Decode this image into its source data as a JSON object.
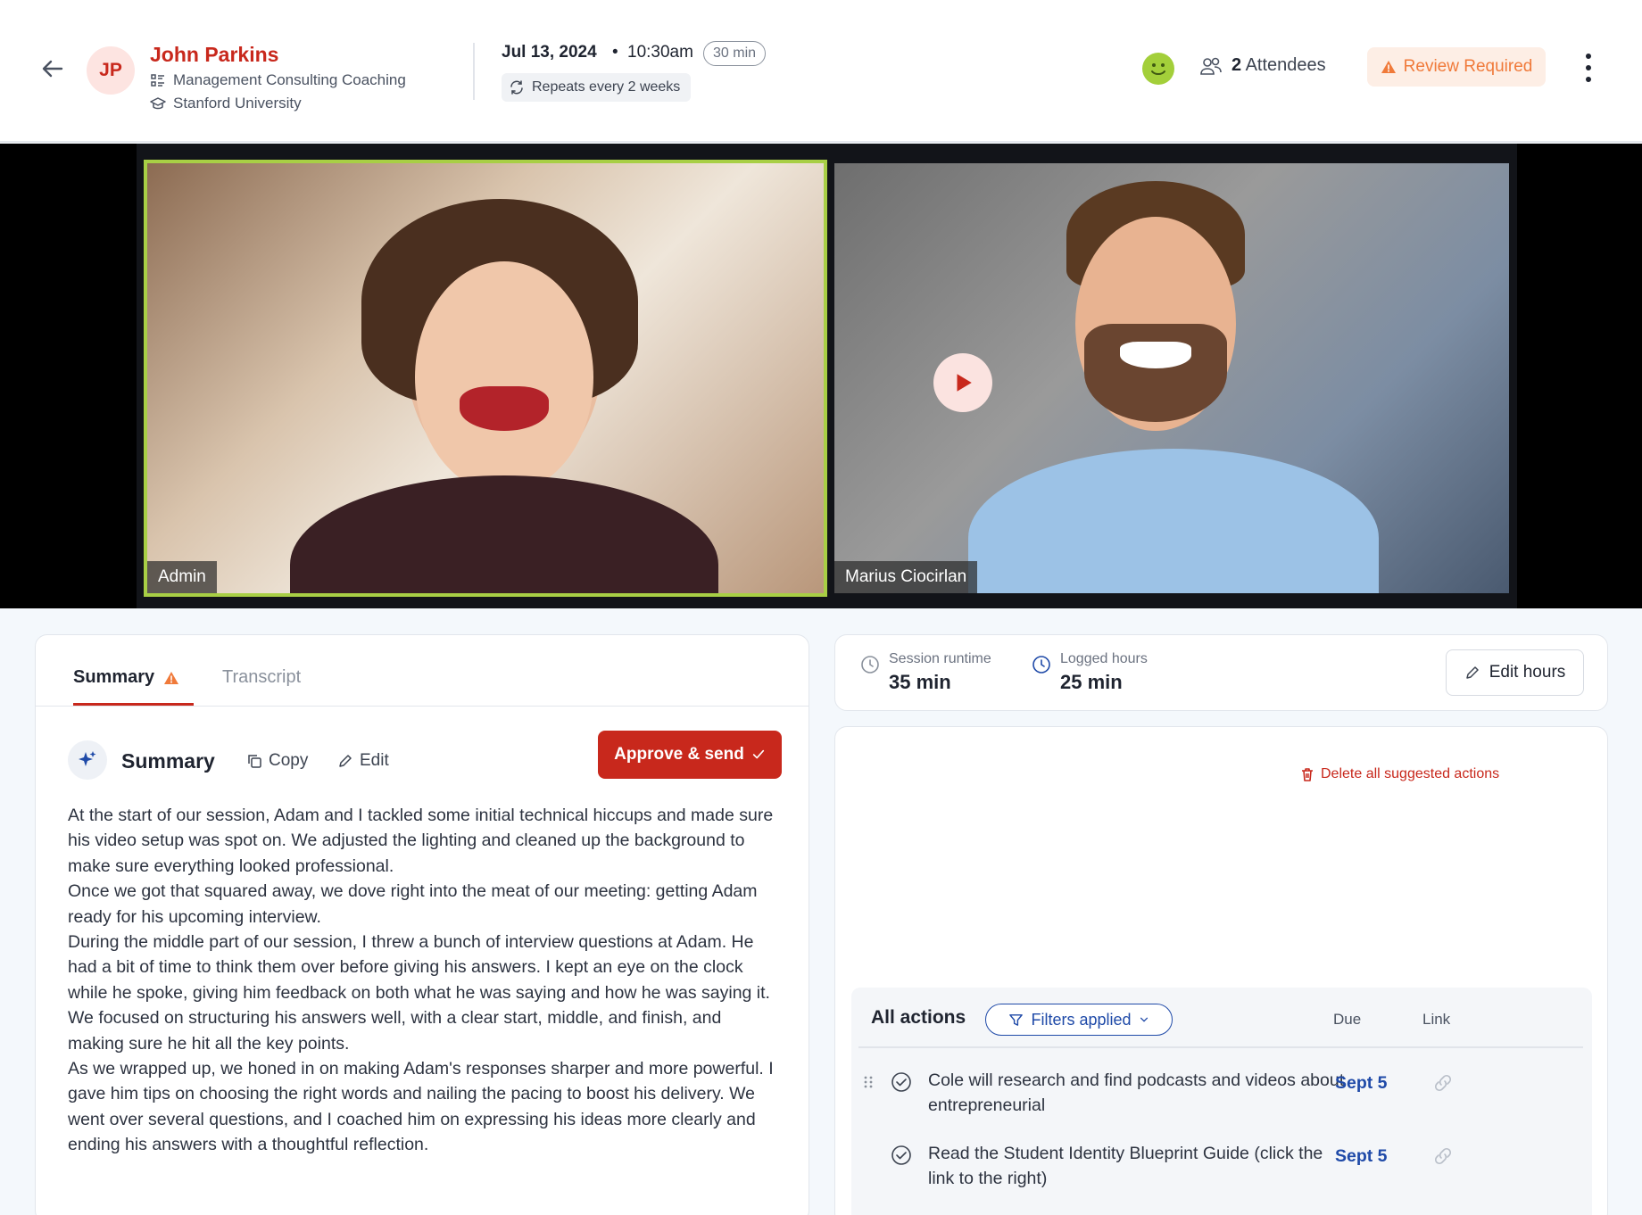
{
  "header": {
    "avatar_initials": "JP",
    "client_name": "John Parkins",
    "program": "Management Consulting Coaching",
    "school": "Stanford University",
    "date": "Jul 13, 2024",
    "dot": "•",
    "time": "10:30am",
    "duration": "30 min",
    "repeats": "Repeats every 2 weeks",
    "attendees_count": "2",
    "attendees_label": "Attendees",
    "review_label": "Review Required"
  },
  "video": {
    "left_label": "Admin",
    "right_label": "Marius Ciocirlan"
  },
  "tabs": {
    "summary": "Summary",
    "transcript": "Transcript"
  },
  "summary": {
    "title": "Summary",
    "copy_label": "Copy",
    "edit_label": "Edit",
    "approve_label": "Approve & send",
    "paragraphs": [
      "At the start of our session, Adam and I tackled some initial technical hiccups and made sure his video setup was spot on. We adjusted the lighting and cleaned up the background to make sure everything looked professional.",
      "Once we got that squared away, we dove right into the meat of our meeting: getting Adam ready for his upcoming interview.",
      "During the middle part of our session, I threw a bunch of interview questions at Adam. He had a bit of time to think them over before giving his answers. I kept an eye on the clock while he spoke, giving him feedback on both what he was saying and how he was saying it. We focused on structuring his answers well, with a clear start, middle, and finish, and making sure he hit all the key points.",
      "As we wrapped up, we honed in on making Adam's responses sharper and more powerful. I gave him tips on choosing the right words and nailing the pacing to boost his delivery. We went over several questions, and I coached him on expressing his ideas more clearly and ending his answers with a thoughtful reflection."
    ]
  },
  "hours": {
    "runtime_label": "Session runtime",
    "runtime_value": "35 min",
    "logged_label": "Logged hours",
    "logged_value": "25 min",
    "edit_label": "Edit hours"
  },
  "actions": {
    "delete_all_label": "Delete all suggested actions",
    "title": "All actions",
    "filters_label": "Filters applied",
    "col_due": "Due",
    "col_link": "Link",
    "items": [
      {
        "text": "Cole will research and find podcasts and videos about entrepreneurial",
        "due": "Sept 5"
      },
      {
        "text": "Read the Student Identity Blueprint Guide (click the link to the right)",
        "due": "Sept 5"
      }
    ]
  },
  "colors": {
    "brand_red": "#c8281c",
    "accent_blue": "#1f4aa8",
    "review_orange": "#f07a3a",
    "speaker_highlight": "#a8cf45"
  }
}
